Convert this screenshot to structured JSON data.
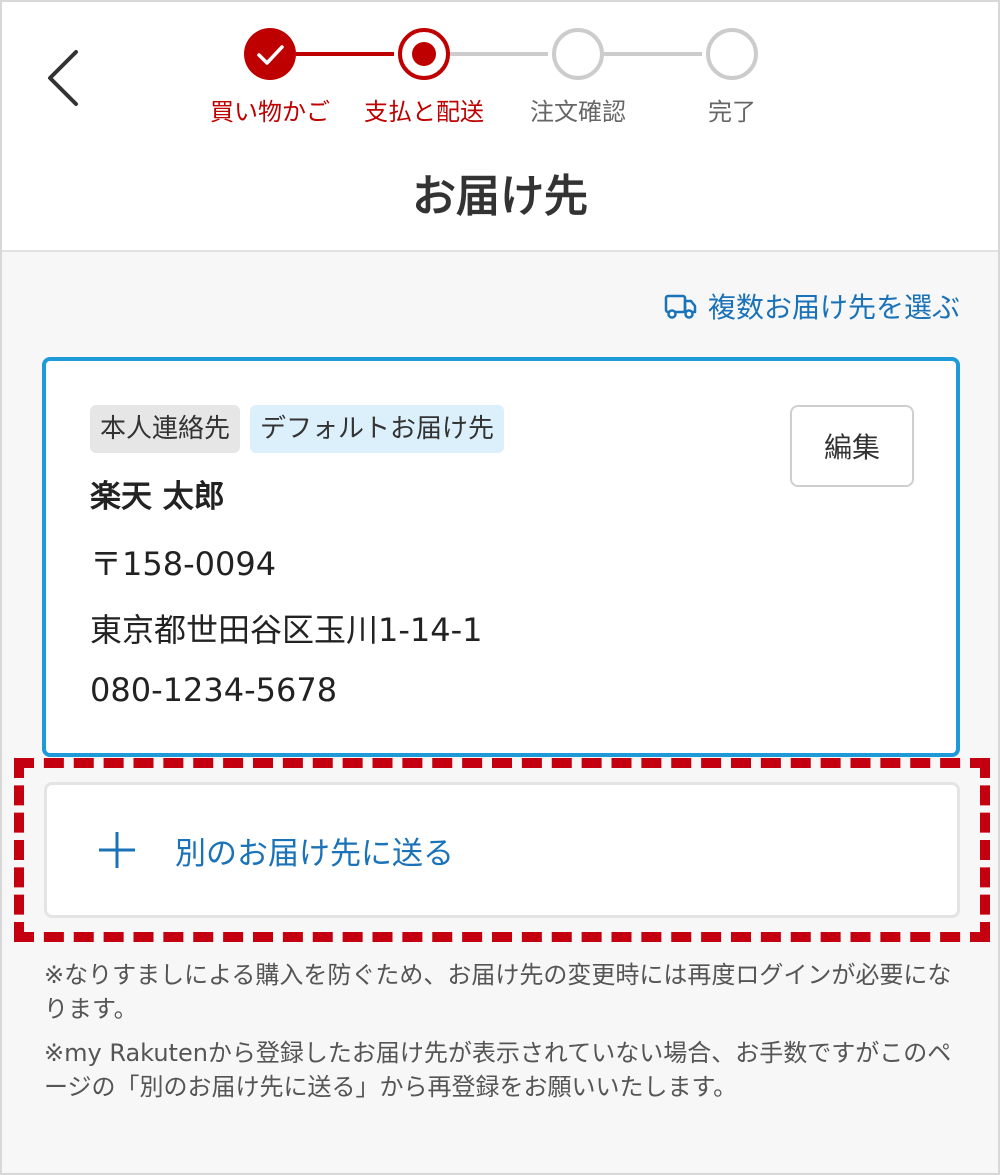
{
  "header": {
    "title": "お届け先",
    "steps": [
      {
        "label": "買い物かご",
        "state": "done"
      },
      {
        "label": "支払と配送",
        "state": "current"
      },
      {
        "label": "注文確認",
        "state": "todo"
      },
      {
        "label": "完了",
        "state": "todo"
      }
    ]
  },
  "icons": {
    "back": "chevron-left-icon",
    "truck": "truck-icon",
    "check": "check-icon",
    "plus": "plus-icon"
  },
  "multi_destination_link": "複数お届け先を選ぶ",
  "address_card": {
    "badges": [
      "本人連絡先",
      "デフォルトお届け先"
    ],
    "edit_label": "編集",
    "name": "楽天 太郎",
    "postal": "〒158-0094",
    "address": "東京都世田谷区玉川1-14-1",
    "phone": "080-1234-5678"
  },
  "other_address_button": "別のお届け先に送る",
  "notes": [
    "※なりすましによる購入を防ぐため、お届け先の変更時には再度ログインが必要になります。",
    "※my Rakutenから登録したお届け先が表示されていない場合、お手数ですがこのページの「別のお届け先に送る」から再登録をお願いいたします。"
  ],
  "colors": {
    "brand_red": "#bf0000",
    "link_blue": "#1a72b8",
    "card_border": "#1e9ad8",
    "highlight_dash": "#c40010",
    "inactive_grey": "#cccccc"
  }
}
